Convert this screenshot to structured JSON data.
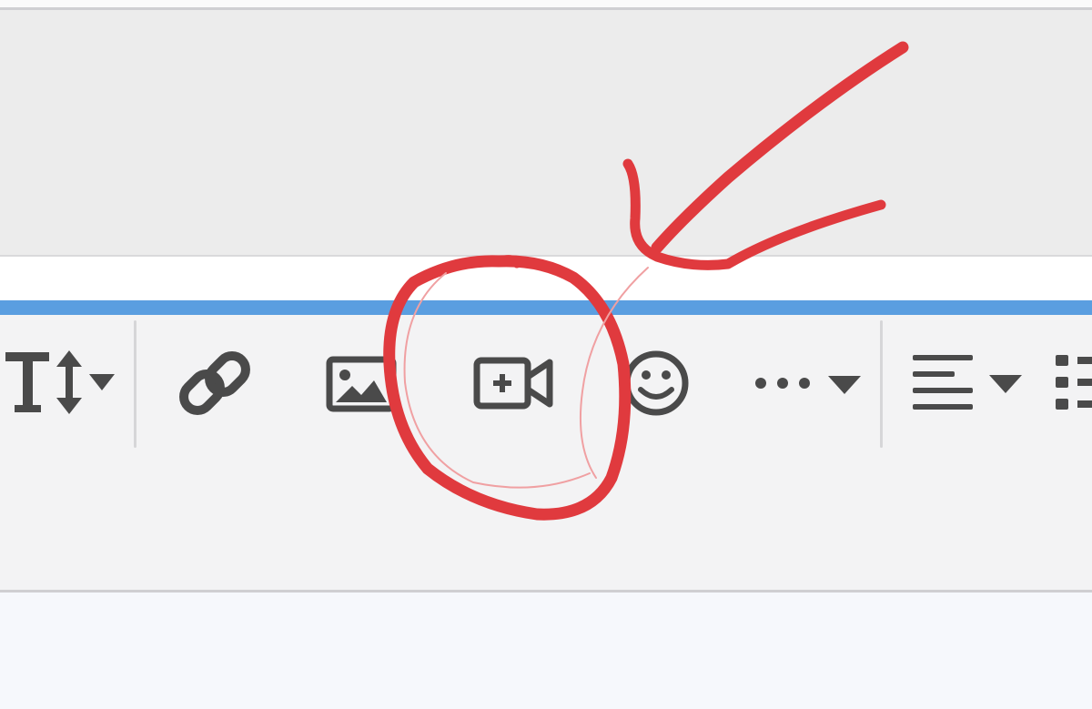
{
  "toolbar": {
    "tools": [
      {
        "id": "text-size",
        "icon": "text-size-icon",
        "has_dropdown": true
      },
      {
        "id": "link",
        "icon": "link-icon",
        "has_dropdown": false
      },
      {
        "id": "image",
        "icon": "image-icon",
        "has_dropdown": false
      },
      {
        "id": "video",
        "icon": "video-add-icon",
        "has_dropdown": false
      },
      {
        "id": "emoji",
        "icon": "emoji-icon",
        "has_dropdown": false
      },
      {
        "id": "more",
        "icon": "more-options-icon",
        "has_dropdown": true
      },
      {
        "id": "align",
        "icon": "align-left-icon",
        "has_dropdown": true
      },
      {
        "id": "list",
        "icon": "list-icon",
        "has_dropdown": false
      }
    ]
  },
  "annotation": {
    "shape": "hand-drawn circle with arrow",
    "target": "video-add-icon",
    "color": "#e03a3e"
  },
  "colors": {
    "icon": "#4a4a4a",
    "accent_line": "#5a9ee0",
    "toolbar_bg": "#f3f3f4",
    "header_bg": "#ececec"
  }
}
